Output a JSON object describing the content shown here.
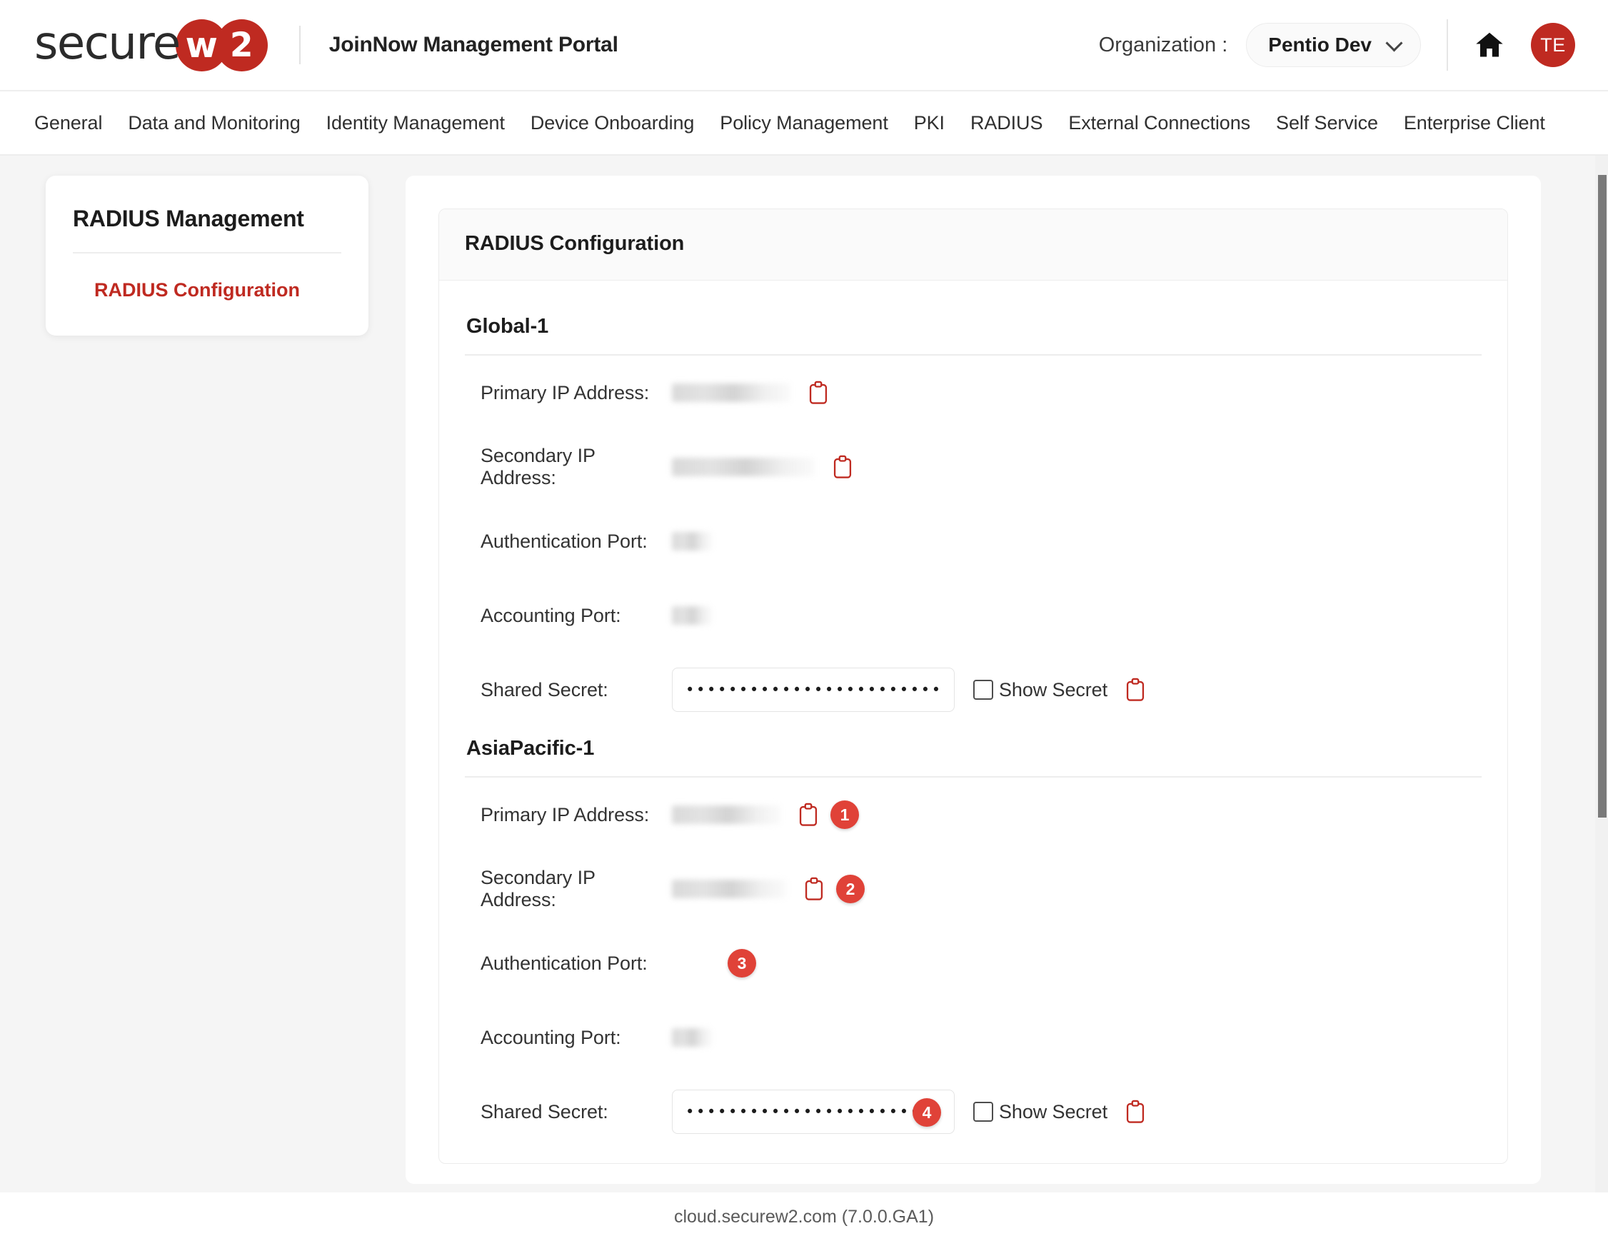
{
  "brand": {
    "logo_text": "secure",
    "logo_circle_1": "w",
    "logo_circle_2": "2",
    "accent_red": "#bf2a21",
    "badge_red": "#e04238"
  },
  "header": {
    "portal_title": "JoinNow Management Portal",
    "organization_label": "Organization :",
    "organization_value": "Pentio Dev",
    "home_icon": "home-icon",
    "chevron_icon": "chevron-down-icon",
    "avatar_initials": "TE"
  },
  "nav": {
    "items": [
      {
        "label": "General"
      },
      {
        "label": "Data and Monitoring"
      },
      {
        "label": "Identity Management"
      },
      {
        "label": "Device Onboarding"
      },
      {
        "label": "Policy Management"
      },
      {
        "label": "PKI"
      },
      {
        "label": "RADIUS"
      },
      {
        "label": "External Connections"
      },
      {
        "label": "Self Service"
      },
      {
        "label": "Enterprise Client"
      }
    ]
  },
  "sidebar": {
    "title": "RADIUS Management",
    "items": [
      {
        "label": "RADIUS Configuration",
        "active": true
      }
    ]
  },
  "main": {
    "card_title": "RADIUS Configuration",
    "sections": [
      {
        "name": "Global-1",
        "rows": [
          {
            "label": "Primary IP Address:",
            "value_state": "redacted",
            "copy_icon": "copy-icon",
            "badge": null
          },
          {
            "label": "Secondary IP Address:",
            "value_state": "redacted",
            "copy_icon": "copy-icon",
            "badge": null
          },
          {
            "label": "Authentication Port:",
            "value_state": "redacted",
            "copy_icon": null,
            "badge": null
          },
          {
            "label": "Accounting Port:",
            "value_state": "redacted",
            "copy_icon": null,
            "badge": null
          }
        ],
        "secret_row": {
          "label": "Shared Secret:",
          "value_masked": "••••••••••••••••••••••••••••",
          "show_secret_label": "Show Secret",
          "show_secret_checked": false,
          "copy_icon": "copy-icon",
          "badge": null
        }
      },
      {
        "name": "AsiaPacific-1",
        "rows": [
          {
            "label": "Primary IP Address:",
            "value_state": "redacted",
            "copy_icon": "copy-icon",
            "badge": "1"
          },
          {
            "label": "Secondary IP Address:",
            "value_state": "redacted",
            "copy_icon": "copy-icon",
            "badge": "2"
          },
          {
            "label": "Authentication Port:",
            "value_state": "hidden-behind-badge",
            "copy_icon": null,
            "badge": "3"
          },
          {
            "label": "Accounting Port:",
            "value_state": "redacted",
            "copy_icon": null,
            "badge": null
          }
        ],
        "secret_row": {
          "label": "Shared Secret:",
          "value_masked": "•••••••••••••••••••••••••••",
          "show_secret_label": "Show Secret",
          "show_secret_checked": false,
          "copy_icon": "copy-icon",
          "badge": "4"
        }
      }
    ]
  },
  "footer": {
    "text": "cloud.securew2.com (7.0.0.GA1)"
  }
}
